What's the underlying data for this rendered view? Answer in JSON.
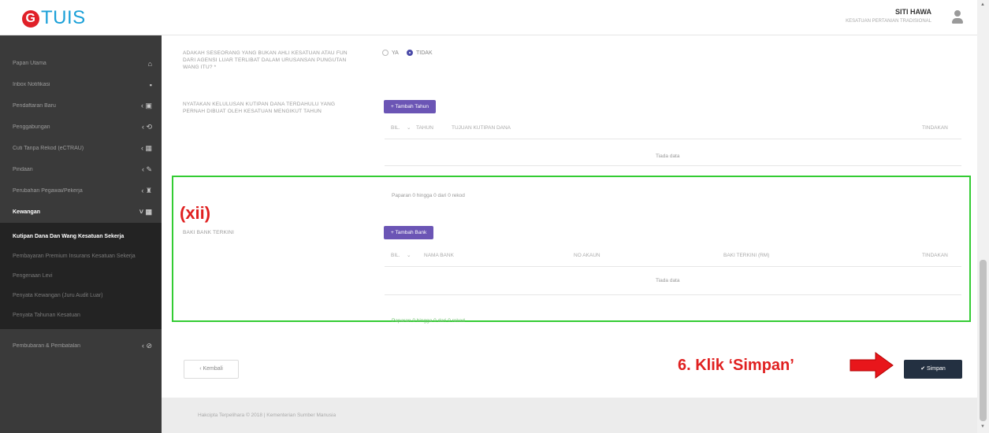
{
  "app": {
    "logo": "TUIS",
    "logo_mark": "G"
  },
  "user": {
    "name": "SITI HAWA",
    "org": "KESATUAN PERTANIAN TRADISIONAL"
  },
  "sidebar": {
    "items": [
      {
        "label": "Papan Utama",
        "icon": "⌂"
      },
      {
        "label": "Inbox Notifikasi",
        "icon": "▪"
      },
      {
        "label": "Pendaftaran Baru",
        "icon": "‹ ▣"
      },
      {
        "label": "Penggabungan",
        "icon": "‹ ⟲"
      },
      {
        "label": "Cuti Tanpa Rekod (eCTRAU)",
        "icon": "‹ ▦"
      },
      {
        "label": "Pindaan",
        "icon": "‹ ✎"
      },
      {
        "label": "Perubahan Pegawai/Pekerja",
        "icon": "‹ ♜"
      },
      {
        "label": "Kewangan",
        "icon": "˅ ▦"
      }
    ],
    "sub": [
      "Kutipan Dana Dan Wang Kesatuan Sekerja",
      "Pembayaran Premium Insurans Kesatuan Sekerja",
      "Pengenaan Levi",
      "Penyata Kewangan (Juru Audit Luar)",
      "Penyata Tahunan Kesatuan"
    ],
    "last": {
      "label": "Pembubaran & Pembatalan",
      "icon": "‹ ⊘"
    }
  },
  "form": {
    "q1": "ADAKAH SESEORANG YANG BUKAN AHLI KESATUAN ATAU FUN DARI AGENSI LUAR TERLIBAT DALAM URUSANSAN PUNGUTAN WANG ITU? *",
    "radio_ya": "YA",
    "radio_tidak": "TIDAK",
    "q2": "NYATAKAN KELULUSAN KUTIPAN DANA TERDAHULU YANG PERNAH DIBUAT OLEH KESATUAN MENGIKUT TAHUN",
    "btn_tahun": "+ Tambah Tahun",
    "t1_cols": [
      "BIL.",
      "TAHUN",
      "TUJUAN KUTIPAN DANA",
      "TINDAKAN"
    ],
    "no_data": "Tiada data",
    "paging": "Paparan 0 hingga 0 dari 0 rekod",
    "q3": "BAKI BANK TERKINI",
    "btn_bank": "+ Tambah Bank",
    "t2_cols": [
      "BIL.",
      "NAMA BANK",
      "NO AKAUN",
      "BAKI TERKINI (RM)",
      "TINDAKAN"
    ],
    "no_data2": "Tiada data",
    "paging2": "Paparan 0 hingga 0 dari 0 rekod"
  },
  "annotation": {
    "label": "(xii)",
    "step": "6. Klik ‘Simpan’"
  },
  "actions": {
    "back": "‹ Kembali",
    "save": "✔ Simpan"
  },
  "footer": {
    "text": "Hakcipta Terpelihara © 2018 | Kementerian Sumber Manusia"
  }
}
